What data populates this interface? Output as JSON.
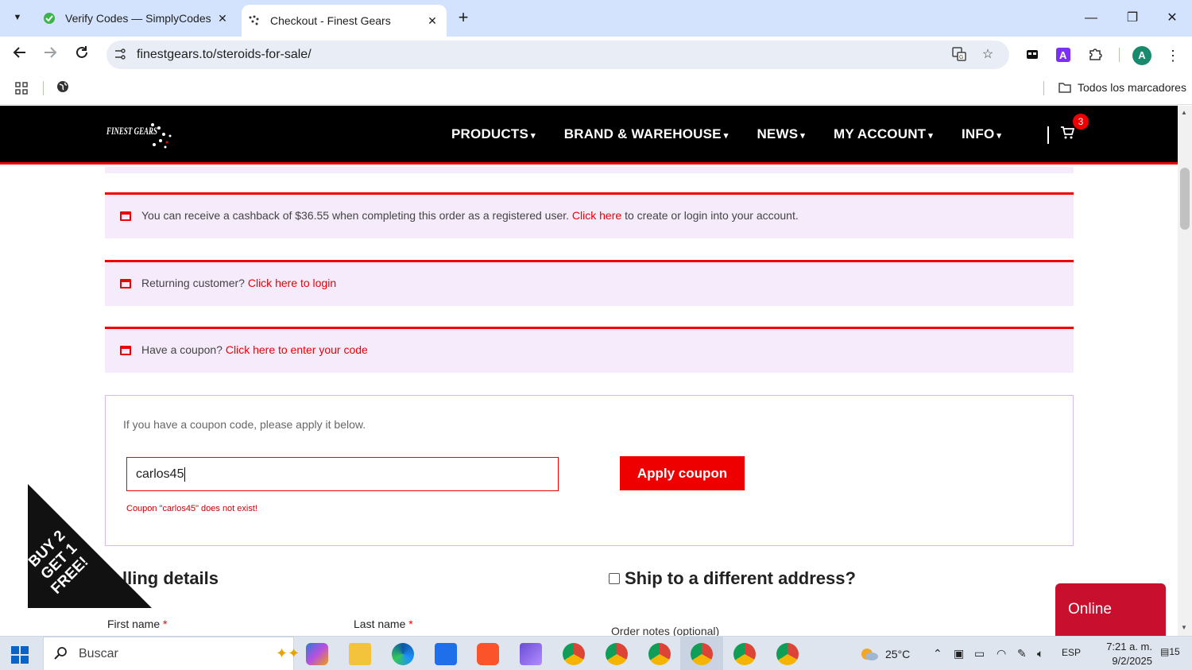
{
  "browser": {
    "tabs": [
      {
        "title": "Verify Codes — SimplyCodes",
        "active": false
      },
      {
        "title": "Checkout - Finest Gears",
        "active": true
      }
    ],
    "url": "finestgears.to/steroids-for-sale/",
    "profile_initial": "A",
    "bookmarks_all": "Todos los marcadores",
    "window_controls": {
      "minimize": "—",
      "restore": "❐",
      "close": "✕"
    }
  },
  "site": {
    "logo_text": "FINEST GEARS",
    "menu": [
      {
        "label": "PRODUCTS"
      },
      {
        "label": "BRAND & WAREHOUSE"
      },
      {
        "label": "NEWS"
      },
      {
        "label": "MY ACCOUNT"
      },
      {
        "label": "INFO"
      }
    ],
    "cart_count": "3",
    "notices": {
      "cashback_text": "You can receive a cashback of $36.55 when completing this order as a registered user.",
      "cashback_link": "Click here",
      "cashback_tail": "to create or login into your account.",
      "returning_text": "Returning customer?",
      "returning_link": "Click here to login",
      "coupon_text": "Have a coupon?",
      "coupon_link": "Click here to enter your code"
    },
    "coupon": {
      "hint": "If you have a coupon code, please apply it below.",
      "value": "carlos45",
      "apply_label": "Apply coupon",
      "error": "Coupon \"carlos45\" does not exist!"
    },
    "billing": {
      "heading": "Billing details",
      "heading_visible": "lling details",
      "ship_label": "Ship to a different address?",
      "first_name": "First name",
      "last_name": "Last name",
      "required_mark": "*",
      "order_notes": "Order notes (optional)"
    },
    "promo_lines": [
      "BUY 2",
      "GET 1",
      "FREE!"
    ],
    "chat_label": "Online",
    "colors": {
      "accent": "#ee0000",
      "notice_bg": "#f5ebfb",
      "chat": "#c8102e"
    }
  },
  "taskbar": {
    "search_placeholder": "Buscar",
    "weather": "25°C",
    "language": "ESP",
    "time": "7:21 a. m.",
    "date": "9/2/2025",
    "notifications": "15"
  }
}
